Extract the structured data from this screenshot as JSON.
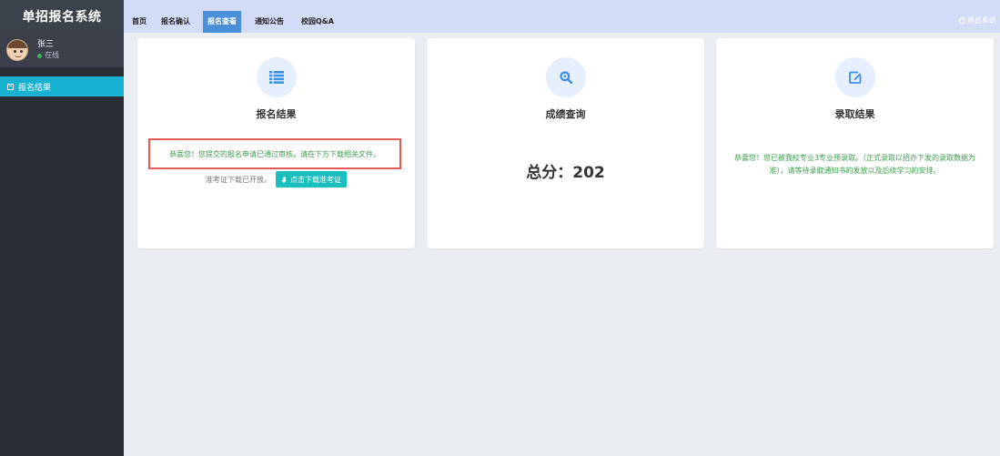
{
  "app": {
    "title": "单招报名系统"
  },
  "user": {
    "name": "张三",
    "status": "在线"
  },
  "sidebar": {
    "items": [
      {
        "label": "报名结果",
        "icon": "form-icon"
      }
    ]
  },
  "nav": {
    "items": [
      {
        "label": "首页",
        "active": false
      },
      {
        "label": "报名确认",
        "active": false
      },
      {
        "label": "报名查看",
        "active": true
      },
      {
        "label": "通知公告",
        "active": false
      },
      {
        "label": "校园Q&A",
        "active": false
      }
    ],
    "logout": "退出系统"
  },
  "cards": {
    "result": {
      "title": "报名结果",
      "icon": "list-icon",
      "message": "恭喜您！您提交的报名申请已通过审核。请在下方下载相关文件。",
      "ticket_note": "准考证下载已开放。",
      "download_button": "点击下载准考证"
    },
    "score": {
      "title": "成绩查询",
      "icon": "search-icon",
      "text": "总分：202"
    },
    "admission": {
      "title": "录取结果",
      "icon": "edit-icon",
      "text": "恭喜您！您已被我校专业3专业预录取。（正式录取以招办下发的录取数据为准），请等待录取通知书的发放以及后续学习的安排。"
    }
  },
  "colors": {
    "accent": "#17b1d1",
    "nav_bg": "#d2dcf7",
    "sidebar_bg": "#2a2e35",
    "success_text": "#3aa04a",
    "highlight_border": "#e25b57",
    "button": "#17bfbf"
  }
}
